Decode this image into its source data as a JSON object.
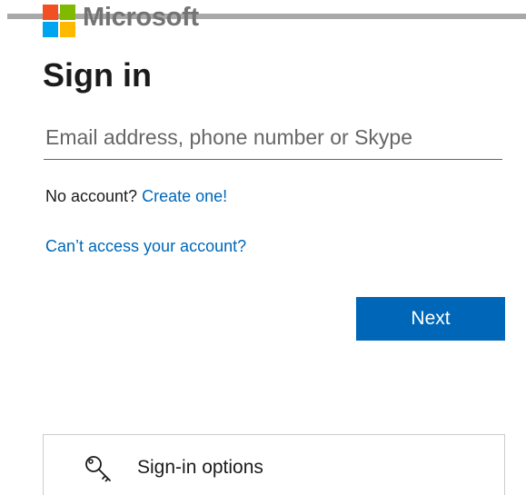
{
  "brand": {
    "name": "Microsoft",
    "colors": {
      "red": "#f25022",
      "green": "#7fba00",
      "blue": "#00a4ef",
      "yellow": "#ffb900"
    }
  },
  "header": {
    "title": "Sign in"
  },
  "email": {
    "placeholder": "Email address, phone number or Skype",
    "value": ""
  },
  "account": {
    "prompt": "No account?",
    "create_link": "Create one!",
    "cant_access_link": "Can’t access your account?"
  },
  "actions": {
    "next_label": "Next"
  },
  "options": {
    "label": "Sign-in options",
    "icon": "key-icon"
  },
  "theme": {
    "accent": "#0067b8",
    "text": "#1b1b1b"
  }
}
